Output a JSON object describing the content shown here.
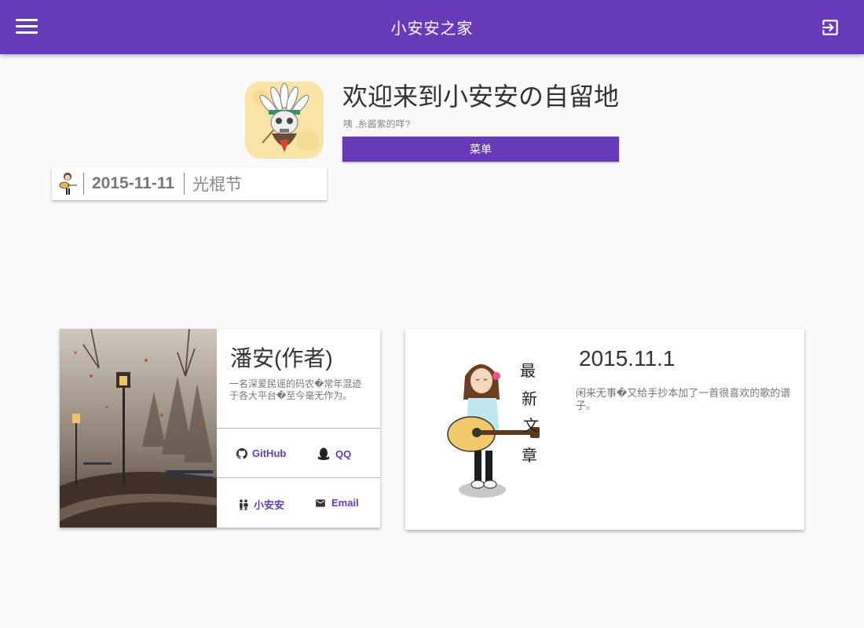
{
  "appbar": {
    "title": "小安安之家",
    "menu_icon": "hamburger-menu-icon",
    "logout_icon": "exit-icon"
  },
  "hero": {
    "welcome": "欢迎来到小安安の自留地",
    "subtitle": "咦 ,糸酱紫的咩?",
    "menu_button_label": "菜单"
  },
  "date_strip": {
    "date": "2015-11-11",
    "holiday": "光棍节"
  },
  "author_card": {
    "name": "潘安(作者)",
    "bio": "一名深爱民谣的码农�常年混迹于各大平台�至今毫无作为。",
    "links": [
      {
        "label": "GitHub",
        "icon": "github-icon"
      },
      {
        "label": "QQ",
        "icon": "qq-penguin-icon"
      },
      {
        "label": "小安安",
        "icon": "people-icon"
      },
      {
        "label": "Email",
        "icon": "mail-icon"
      }
    ]
  },
  "article_card": {
    "date": "2015.11.1",
    "description": "闲来无事�又给手抄本加了一首很喜欢的歌的谱子。",
    "art_text": [
      "最",
      "新",
      "文",
      "章"
    ]
  },
  "colors": {
    "primary": "#673ab7",
    "background": "#fafafa"
  }
}
